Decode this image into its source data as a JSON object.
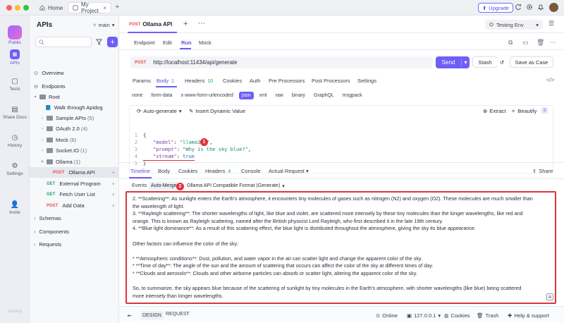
{
  "colors": {
    "accent": "#6f5ef5",
    "post": "#e5534b",
    "get": "#22a565",
    "highlight": "#d9363e"
  },
  "topbar": {
    "tabs": [
      {
        "label": "Home"
      },
      {
        "label": "My Project"
      }
    ],
    "upgrade_label": "Upgrade"
  },
  "rail": {
    "workspace_label": "Public",
    "items": [
      {
        "label": "APIs",
        "icon": "apis-icon"
      },
      {
        "label": "Tests",
        "icon": "tests-icon"
      },
      {
        "label": "Share Docs",
        "icon": "share-docs-icon"
      },
      {
        "label": "History",
        "icon": "history-icon"
      },
      {
        "label": "Settings",
        "icon": "settings-icon"
      },
      {
        "label": "Invite",
        "icon": "invite-icon"
      }
    ],
    "bottom_label": "Apidog"
  },
  "sidebar": {
    "title": "APIs",
    "branch": "main",
    "search_placeholder": "",
    "tree": [
      {
        "label": "Overview"
      },
      {
        "label": "Endpoints"
      },
      {
        "label": "Root"
      },
      {
        "label": "Walk through Apidog"
      },
      {
        "label": "Sample APIs",
        "count": "(5)"
      },
      {
        "label": "OAuth 2.0",
        "count": "(4)"
      },
      {
        "label": "Mock",
        "count": "(6)"
      },
      {
        "label": "Socket.IO",
        "count": "(1)"
      },
      {
        "label": "Ollama",
        "count": "(1)"
      },
      {
        "method": "POST",
        "label": "Ollama API"
      },
      {
        "method": "GET",
        "label": "External Program"
      },
      {
        "method": "GET",
        "label": "Fetch User List"
      },
      {
        "method": "POST",
        "label": "Add Data"
      },
      {
        "label": "Schemas"
      },
      {
        "label": "Components"
      },
      {
        "label": "Requests"
      }
    ]
  },
  "request": {
    "tab_method": "POST",
    "tab_title": "Ollama API",
    "environment": "Testing Env",
    "mode_tabs": [
      "Endpoint",
      "Edit",
      "Run",
      "Mock"
    ],
    "method": "POST",
    "url": "http://localhost:11434/api/generate",
    "send_label": "Send",
    "stash_label": "Stash",
    "save_label": "Save as Case",
    "param_tabs": [
      {
        "label": "Params"
      },
      {
        "label": "Body",
        "count": "1"
      },
      {
        "label": "Headers",
        "count": "10"
      },
      {
        "label": "Cookies"
      },
      {
        "label": "Auth"
      },
      {
        "label": "Pre Processors"
      },
      {
        "label": "Post Processors"
      },
      {
        "label": "Settings"
      }
    ],
    "body_types": [
      "none",
      "form-data",
      "x-www-form-urlencoded",
      "json",
      "xml",
      "raw",
      "binary",
      "GraphQL",
      "msgpack"
    ],
    "auto_generate_label": "Auto-generate",
    "insert_var_label": "Insert Dynamic Value",
    "extract_label": "Extract",
    "beautify_label": "Beautify",
    "code": {
      "l1": "{",
      "model_key": "\"model\"",
      "model_val": "\"llama3.2\"",
      "prompt_key": "\"prompt\"",
      "prompt_val": "\"Why is the sky blue?\"",
      "stream_key": "\"stream\"",
      "stream_val": "true",
      "l5": "}"
    },
    "marker1": "1"
  },
  "response": {
    "tabs": [
      {
        "label": "Timeline"
      },
      {
        "label": "Body"
      },
      {
        "label": "Cookies"
      },
      {
        "label": "Headers",
        "count": "4"
      },
      {
        "label": "Console"
      },
      {
        "label": "Actual Request"
      }
    ],
    "share_label": "Share",
    "sub_events": "Events",
    "sub_auto": "Auto-Merge",
    "marker2": "2",
    "format_label": "Ollama API Compatible Format (Generate)",
    "lines": [
      "2. **Scattering**: As sunlight enters the Earth's atmosphere, it encounters tiny molecules of gases such as nitrogen (N2) and oxygen (O2). These molecules are much smaller than",
      "the wavelength of light.",
      "3. **Rayleigh scattering**: The shorter wavelengths of light, like blue and violet, are scattered more intensely by these tiny molecules than the longer wavelengths, like red and",
      "orange. This is known as Rayleigh scattering, named after the British physicist Lord Rayleigh, who first described it in the late 19th century.",
      "4. **Blue light dominance**: As a result of this scattering effect, the blue light is distributed throughout the atmosphere, giving the sky its blue appearance.",
      "",
      "Other factors can influence the color of the sky:",
      "",
      "* **Atmospheric conditions**: Dust, pollution, and water vapor in the air can scatter light and change the apparent color of the sky.",
      "* **Time of day**: The angle of the sun and the amount of scattering that occurs can affect the color of the sky at different times of day.",
      "* **Clouds and aerosols**: Clouds and other airborne particles can absorb or scatter light, altering the apparent color of the sky.",
      "",
      "So, to summarize, the sky appears blue because of the scattering of sunlight by tiny molecules in the Earth's atmosphere, with shorter wavelengths (like blue) being scattered",
      "more intensely than longer wavelengths."
    ]
  },
  "statusbar": {
    "design_label": "DESIGN",
    "request_label": "REQUEST",
    "online_label": "Online",
    "ip_label": "127.0.0.1",
    "cookies_label": "Cookies",
    "trash_label": "Trash",
    "help_label": "Help & support"
  }
}
